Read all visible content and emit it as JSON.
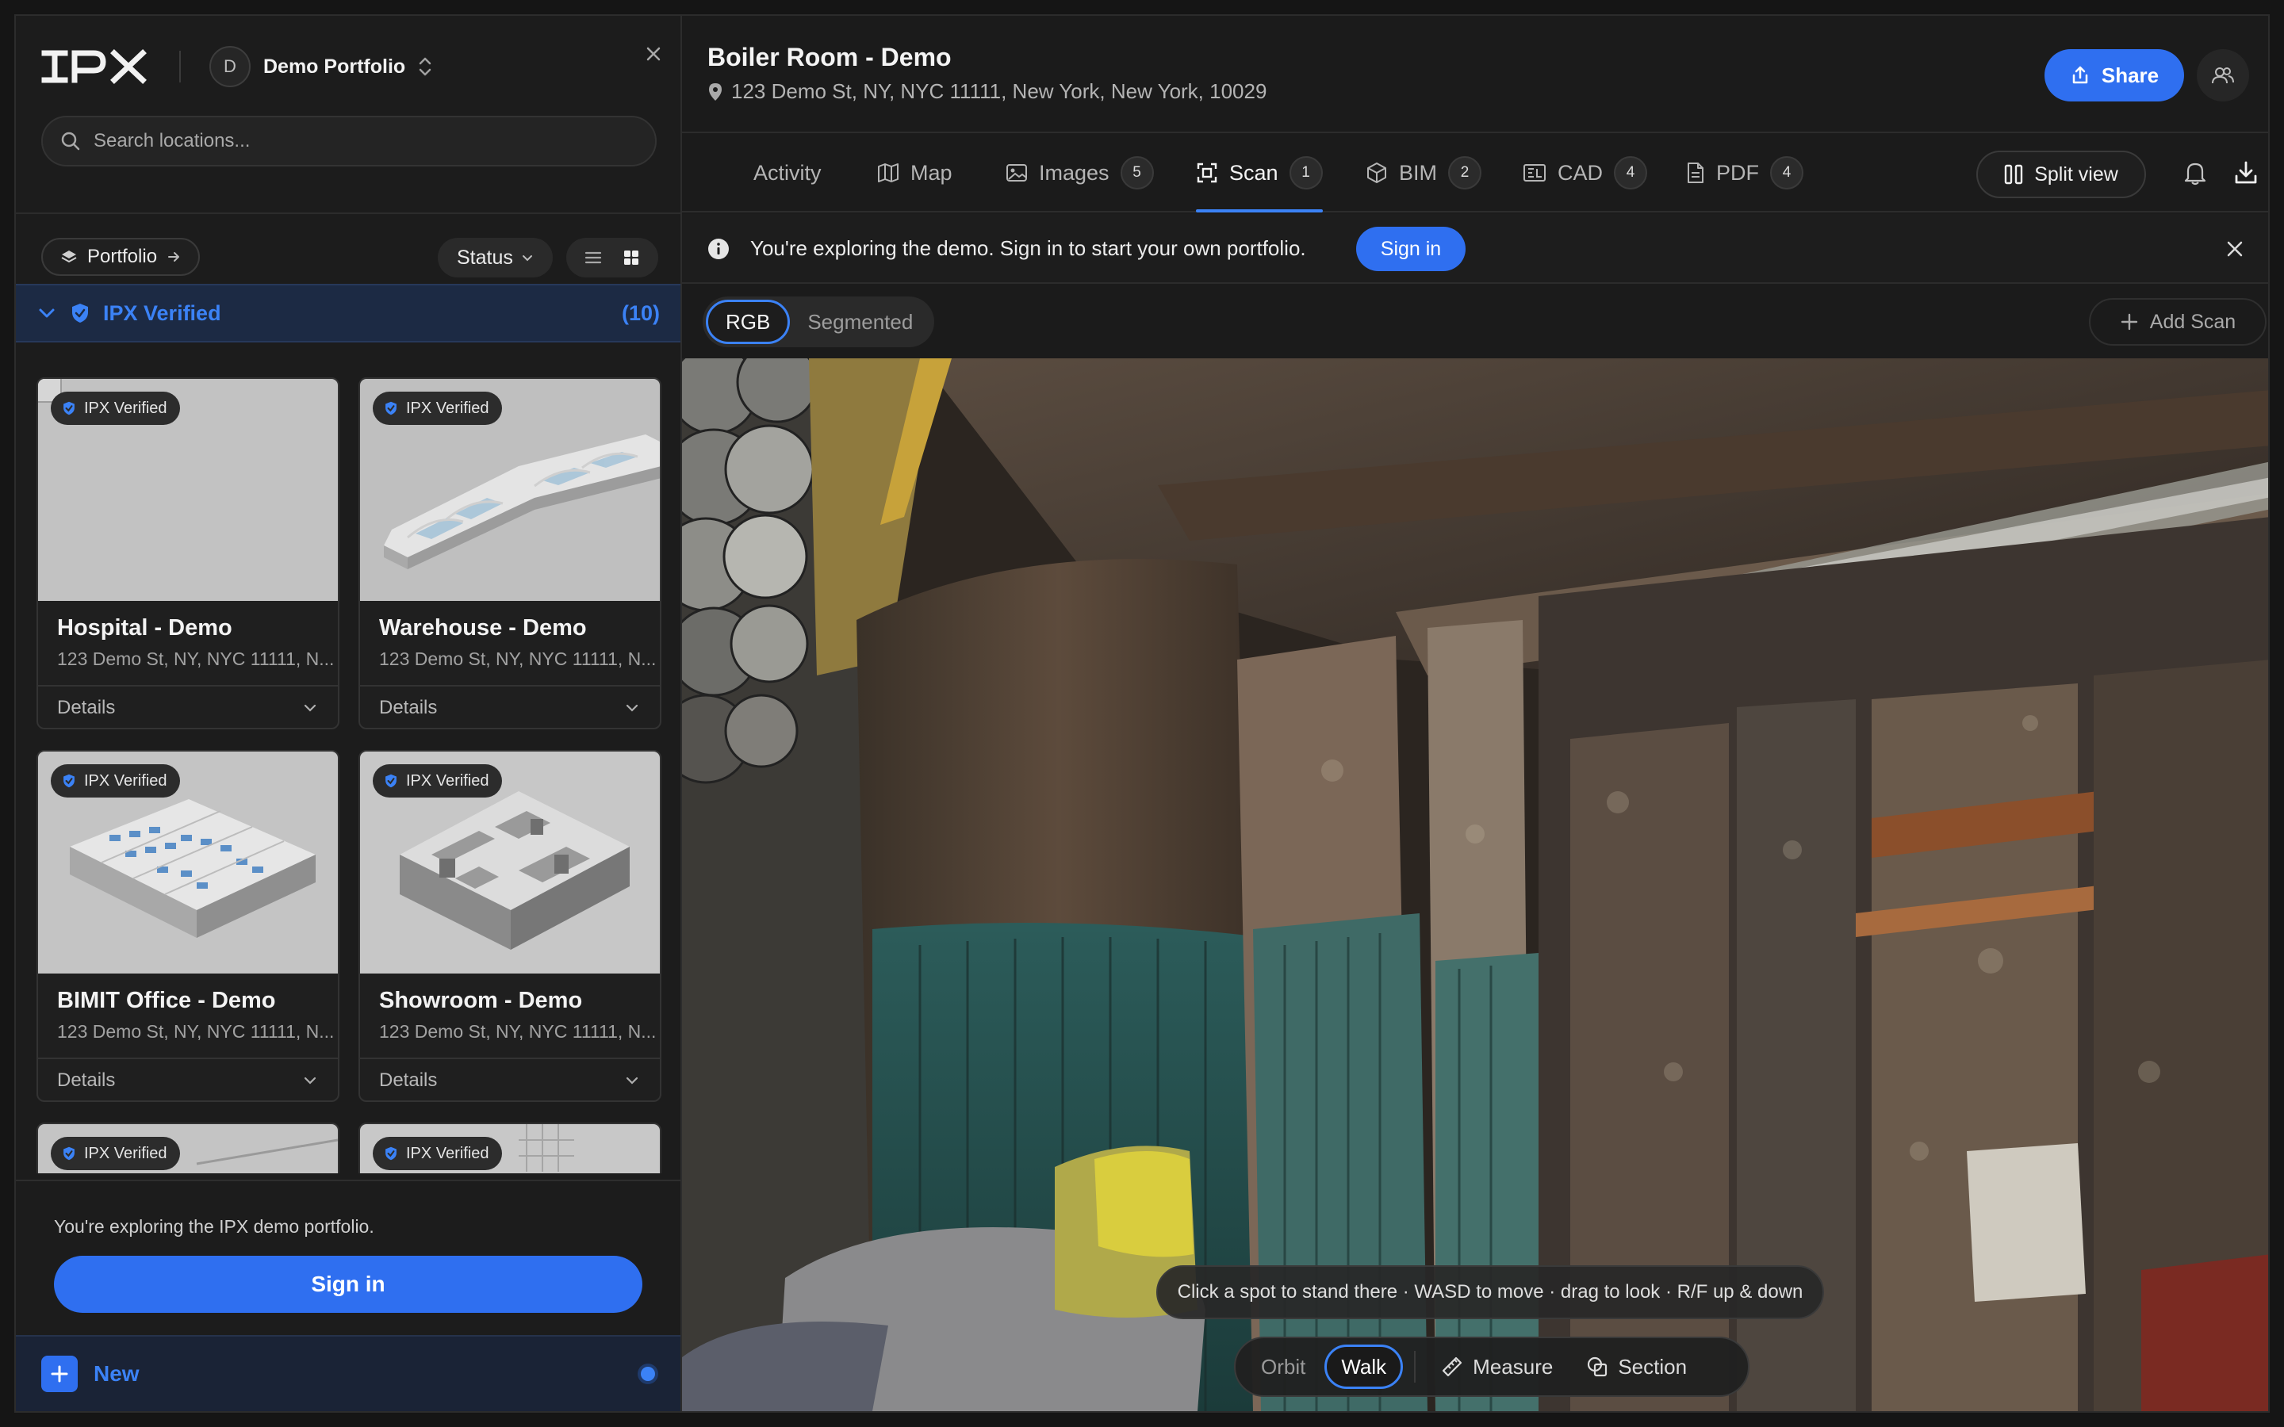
{
  "sidebar": {
    "portfolio_avatar": "D",
    "portfolio_name": "Demo Portfolio",
    "search_placeholder": "Search locations...",
    "portfolio_button": "Portfolio",
    "status_button": "Status",
    "group": {
      "title": "IPX Verified",
      "count": "(10)"
    },
    "badge_label": "IPX Verified",
    "cards": [
      {
        "title": "Hospital - Demo",
        "address": "123 Demo St, NY, NYC 11111, N...",
        "details": "Details",
        "image": "blank"
      },
      {
        "title": "Warehouse - Demo",
        "address": "123 Demo St, NY, NYC 11111, N...",
        "details": "Details",
        "image": "warehouse-render"
      },
      {
        "title": "BIMIT Office - Demo",
        "address": "123 Demo St, NY, NYC 11111, N...",
        "details": "Details",
        "image": "office-render"
      },
      {
        "title": "Showroom - Demo",
        "address": "123 Demo St, NY, NYC 11111, N...",
        "details": "Details",
        "image": "showroom-render"
      },
      {
        "title": "",
        "address": "",
        "details": "",
        "image": "partial"
      },
      {
        "title": "",
        "address": "",
        "details": "",
        "image": "partial"
      }
    ],
    "signin_text": "You're exploring the IPX demo portfolio.",
    "signin_button": "Sign in",
    "new_label": "New"
  },
  "main": {
    "title": "Boiler Room - Demo",
    "address": "123 Demo St, NY, NYC 11111, New York, New York, 10029",
    "share_label": "Share",
    "tabs": [
      {
        "label": "Activity",
        "count": null,
        "icon": "none"
      },
      {
        "label": "Map",
        "count": null,
        "icon": "map-icon"
      },
      {
        "label": "Images",
        "count": "5",
        "icon": "image-icon"
      },
      {
        "label": "Scan",
        "count": "1",
        "icon": "scan-icon",
        "active": true
      },
      {
        "label": "BIM",
        "count": "2",
        "icon": "cube-icon"
      },
      {
        "label": "CAD",
        "count": "4",
        "icon": "cad-icon"
      },
      {
        "label": "PDF",
        "count": "4",
        "icon": "file-icon"
      }
    ],
    "split_view_label": "Split view",
    "banner": {
      "text": "You're exploring the demo. Sign in to start your own portfolio.",
      "button": "Sign in"
    },
    "scan": {
      "modes": [
        "RGB",
        "Segmented"
      ],
      "active_mode": "RGB",
      "add_scan_label": "Add Scan",
      "hint": "Click a spot to stand there · WASD to move · drag to look · R/F up & down",
      "toolbar": {
        "orbit": "Orbit",
        "walk": "Walk",
        "measure": "Measure",
        "section": "Section",
        "active": "Walk"
      }
    }
  },
  "colors": {
    "accent": "#3b82f6",
    "button": "#2f6ff0",
    "background": "#1b1b1b"
  }
}
